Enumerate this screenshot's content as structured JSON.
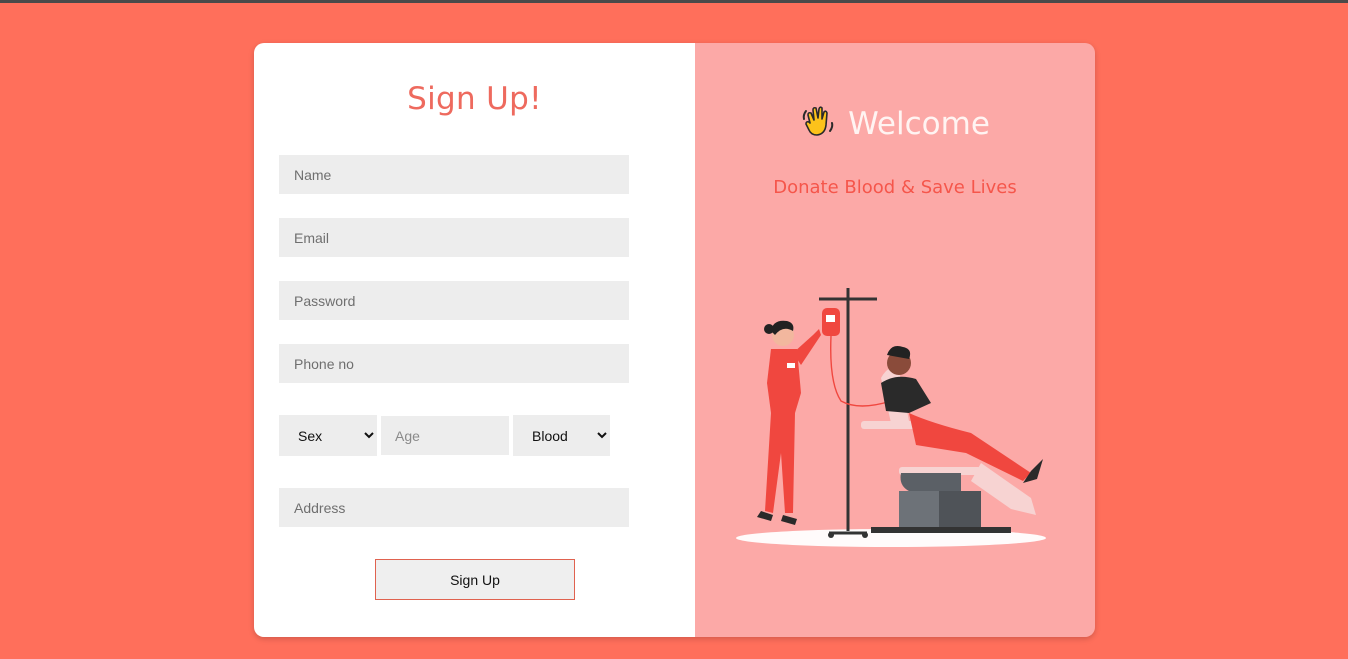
{
  "signup": {
    "title": "Sign Up!",
    "name_placeholder": "Name",
    "email_placeholder": "Email",
    "password_placeholder": "Password",
    "phone_placeholder": "Phone no",
    "sex_selected": "Sex",
    "age_placeholder": "Age",
    "blood_selected": "Blood",
    "address_placeholder": "Address",
    "button_label": "Sign Up"
  },
  "welcome": {
    "icon": "waving-hand-icon",
    "title": "Welcome",
    "tagline": "Donate Blood & Save Lives",
    "illustration": "blood-donation-illustration"
  },
  "colors": {
    "background": "#ff6f5b",
    "panel_left": "#ffffff",
    "panel_right": "#fca9a7",
    "title_accent": "#ee6a5e",
    "tagline": "#f5564b",
    "input_bg": "#ededed",
    "button_border": "#e0624f"
  }
}
